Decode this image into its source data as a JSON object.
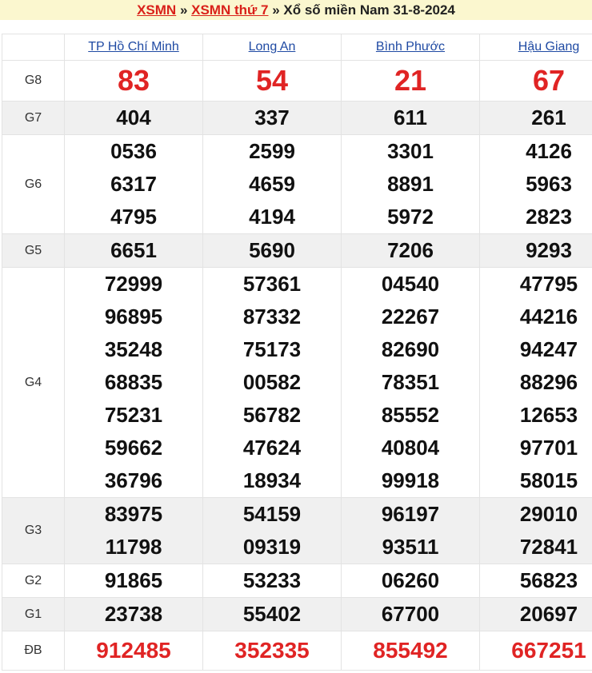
{
  "header": {
    "link1": "XSMN",
    "sep1": " » ",
    "link2": "XSMN thứ 7",
    "sep2": " » ",
    "title": "Xổ số miền Nam 31-8-2024"
  },
  "provinces": [
    "TP Hồ Chí Minh",
    "Long An",
    "Bình Phước",
    "Hậu Giang"
  ],
  "rows": [
    {
      "label": "G8",
      "numbers": [
        [
          "83"
        ],
        [
          "54"
        ],
        [
          "21"
        ],
        [
          "67"
        ]
      ]
    },
    {
      "label": "G7",
      "numbers": [
        [
          "404"
        ],
        [
          "337"
        ],
        [
          "611"
        ],
        [
          "261"
        ]
      ]
    },
    {
      "label": "G6",
      "numbers": [
        [
          "0536",
          "6317",
          "4795"
        ],
        [
          "2599",
          "4659",
          "4194"
        ],
        [
          "3301",
          "8891",
          "5972"
        ],
        [
          "4126",
          "5963",
          "2823"
        ]
      ]
    },
    {
      "label": "G5",
      "numbers": [
        [
          "6651"
        ],
        [
          "5690"
        ],
        [
          "7206"
        ],
        [
          "9293"
        ]
      ]
    },
    {
      "label": "G4",
      "numbers": [
        [
          "72999",
          "96895",
          "35248",
          "68835",
          "75231",
          "59662",
          "36796"
        ],
        [
          "57361",
          "87332",
          "75173",
          "00582",
          "56782",
          "47624",
          "18934"
        ],
        [
          "04540",
          "22267",
          "82690",
          "78351",
          "85552",
          "40804",
          "99918"
        ],
        [
          "47795",
          "44216",
          "94247",
          "88296",
          "12653",
          "97701",
          "58015"
        ]
      ]
    },
    {
      "label": "G3",
      "numbers": [
        [
          "83975",
          "11798"
        ],
        [
          "54159",
          "09319"
        ],
        [
          "96197",
          "93511"
        ],
        [
          "29010",
          "72841"
        ]
      ]
    },
    {
      "label": "G2",
      "numbers": [
        [
          "91865"
        ],
        [
          "53233"
        ],
        [
          "06260"
        ],
        [
          "56823"
        ]
      ]
    },
    {
      "label": "G1",
      "numbers": [
        [
          "23738"
        ],
        [
          "55402"
        ],
        [
          "67700"
        ],
        [
          "20697"
        ]
      ]
    },
    {
      "label": "ĐB",
      "numbers": [
        [
          "912485"
        ],
        [
          "352335"
        ],
        [
          "855492"
        ],
        [
          "667251"
        ]
      ]
    }
  ],
  "colors": {
    "accent_red": "#e02424",
    "link_blue": "#1f4aa3",
    "title_bg": "#fbf7cf",
    "row_shade": "#f0f0f0"
  }
}
